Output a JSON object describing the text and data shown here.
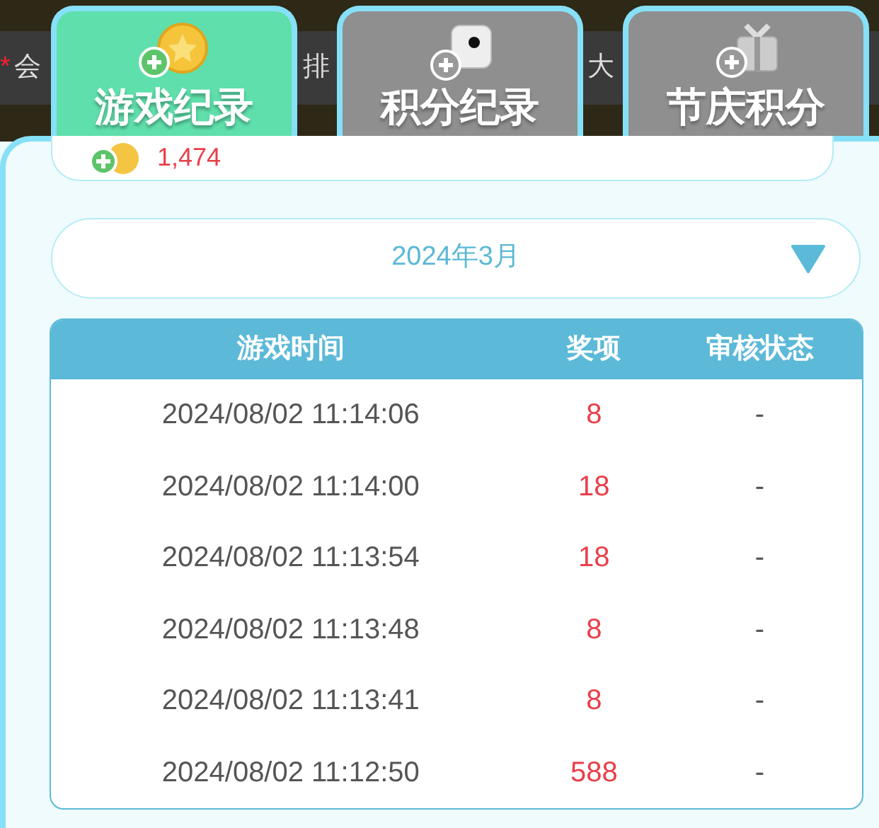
{
  "background_bar": {
    "star": "*",
    "fragments": [
      "会",
      "排",
      "大"
    ]
  },
  "tabs": [
    {
      "label": "游戏纪录",
      "kind": "coin",
      "selected": true
    },
    {
      "label": "积分纪录",
      "kind": "dice",
      "selected": false
    },
    {
      "label": "节庆积分",
      "kind": "gift",
      "selected": false
    }
  ],
  "balance": {
    "value": "1,474"
  },
  "month_select": {
    "value": "2024年3月"
  },
  "table": {
    "columns": [
      "游戏时间",
      "奖项",
      "审核状态"
    ],
    "rows": [
      [
        "2024/08/02 11:14:06",
        "8",
        "-"
      ],
      [
        "2024/08/02 11:14:00",
        "18",
        "-"
      ],
      [
        "2024/08/02 11:13:54",
        "18",
        "-"
      ],
      [
        "2024/08/02 11:13:48",
        "8",
        "-"
      ],
      [
        "2024/08/02 11:13:41",
        "8",
        "-"
      ],
      [
        "2024/08/02 11:12:50",
        "588",
        "-"
      ]
    ]
  }
}
